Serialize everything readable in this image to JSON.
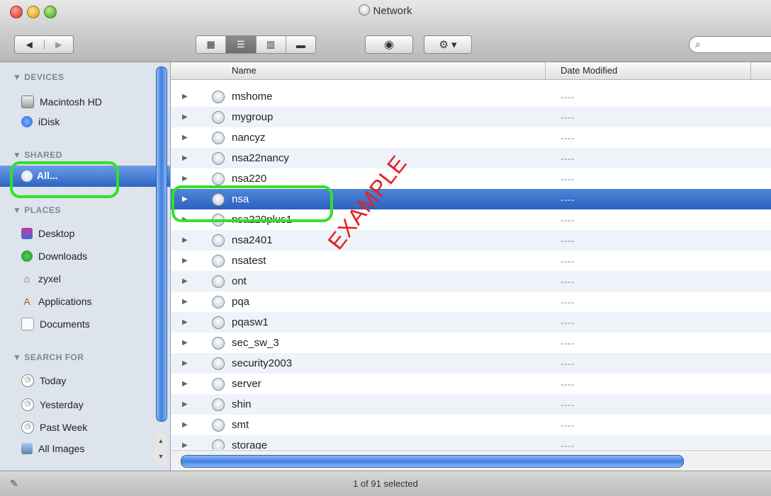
{
  "window": {
    "title": "Network"
  },
  "toolbar": {
    "back_icon": "◀",
    "forward_icon": "▶",
    "view_icons": [
      "▦",
      "☰",
      "▥",
      "▬"
    ],
    "eye_icon": "◉",
    "gear_icon": "⚙ ▾",
    "search_icon": "⌕",
    "search_value": ""
  },
  "sidebar": {
    "devices": {
      "header": "▼ DEVICES",
      "items": [
        {
          "label": "Macintosh HD",
          "icon": "hard-drive-icon"
        },
        {
          "label": "iDisk",
          "icon": "idisk-icon"
        }
      ]
    },
    "shared": {
      "header": "▼ SHARED",
      "items": [
        {
          "label": "All...",
          "icon": "network-icon",
          "selected": true
        }
      ]
    },
    "places": {
      "header": "▼ PLACES",
      "items": [
        {
          "label": "Desktop",
          "icon": "desktop-icon"
        },
        {
          "label": "Downloads",
          "icon": "downloads-icon"
        },
        {
          "label": "zyxel",
          "icon": "home-icon"
        },
        {
          "label": "Applications",
          "icon": "applications-icon"
        },
        {
          "label": "Documents",
          "icon": "documents-icon"
        }
      ]
    },
    "search_for": {
      "header": "▼ SEARCH FOR",
      "items": [
        {
          "label": "Today",
          "icon": "clock-icon"
        },
        {
          "label": "Yesterday",
          "icon": "clock-icon"
        },
        {
          "label": "Past Week",
          "icon": "clock-icon"
        },
        {
          "label": "All Images",
          "icon": "images-icon"
        }
      ]
    }
  },
  "columns": {
    "name": "Name",
    "date": "Date Modified"
  },
  "rows": [
    {
      "name": "mshome",
      "date": "----"
    },
    {
      "name": "mygroup",
      "date": "----"
    },
    {
      "name": "nancyz",
      "date": "----"
    },
    {
      "name": "nsa22nancy",
      "date": "----"
    },
    {
      "name": "nsa220",
      "date": "----"
    },
    {
      "name": "nsa",
      "date": "----",
      "selected": true
    },
    {
      "name": "nsa220plus1",
      "date": "----"
    },
    {
      "name": "nsa2401",
      "date": "----"
    },
    {
      "name": "nsatest",
      "date": "----"
    },
    {
      "name": "ont",
      "date": "----"
    },
    {
      "name": "pqa",
      "date": "----"
    },
    {
      "name": "pqasw1",
      "date": "----"
    },
    {
      "name": "sec_sw_3",
      "date": "----"
    },
    {
      "name": "security2003",
      "date": "----"
    },
    {
      "name": "server",
      "date": "----"
    },
    {
      "name": "shin",
      "date": "----"
    },
    {
      "name": "smt",
      "date": "----"
    },
    {
      "name": "storage",
      "date": "----"
    }
  ],
  "watermark": "EXAMPLE",
  "status": {
    "text": "1 of 91 selected"
  },
  "colors": {
    "highlight": "#32e02c",
    "selection": "#2a62c0",
    "watermark": "#e52020"
  }
}
